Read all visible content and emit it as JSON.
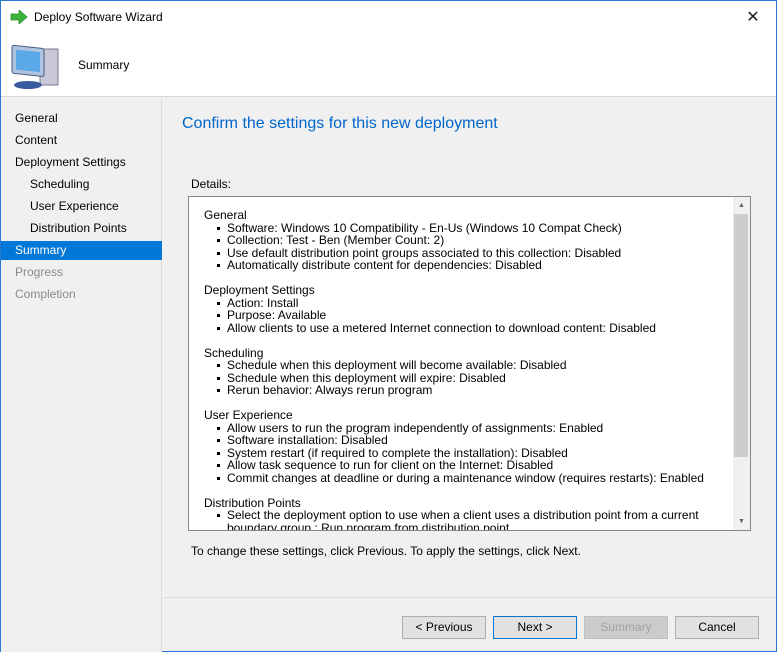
{
  "window": {
    "title": "Deploy Software Wizard",
    "close": "✕"
  },
  "header": {
    "step_title": "Summary"
  },
  "sidebar": {
    "items": [
      {
        "label": "General",
        "level": 0,
        "state": "normal"
      },
      {
        "label": "Content",
        "level": 0,
        "state": "normal"
      },
      {
        "label": "Deployment Settings",
        "level": 0,
        "state": "normal"
      },
      {
        "label": "Scheduling",
        "level": 1,
        "state": "normal"
      },
      {
        "label": "User Experience",
        "level": 1,
        "state": "normal"
      },
      {
        "label": "Distribution Points",
        "level": 1,
        "state": "normal"
      },
      {
        "label": "Summary",
        "level": 0,
        "state": "selected"
      },
      {
        "label": "Progress",
        "level": 0,
        "state": "disabled"
      },
      {
        "label": "Completion",
        "level": 0,
        "state": "disabled"
      }
    ]
  },
  "main": {
    "heading": "Confirm the settings for this new deployment",
    "details_label": "Details:",
    "sections": [
      {
        "title": "General",
        "items": [
          "Software: Windows 10 Compatibility - En-Us (Windows 10 Compat Check)",
          "Collection: Test - Ben (Member Count: 2)",
          "Use default distribution point groups associated to this collection: Disabled",
          "Automatically distribute content for dependencies: Disabled"
        ]
      },
      {
        "title": "Deployment Settings",
        "items": [
          "Action: Install",
          "Purpose: Available",
          "Allow clients to use a metered Internet connection to download content: Disabled"
        ]
      },
      {
        "title": "Scheduling",
        "items": [
          "Schedule when this deployment will become available: Disabled",
          "Schedule when this deployment will expire: Disabled",
          "Rerun behavior: Always rerun program"
        ]
      },
      {
        "title": "User Experience",
        "items": [
          "Allow users to run the program independently of assignments: Enabled",
          "Software installation: Disabled",
          "System restart (if required to complete the installation): Disabled",
          "Allow task sequence to run for client on the Internet: Disabled",
          "Commit changes at deadline or during a maintenance window (requires restarts): Enabled"
        ]
      },
      {
        "title": "Distribution Points",
        "items": [
          "Select the deployment option to use when a client uses a distribution point from a current boundary group.: Run program from distribution point"
        ]
      }
    ],
    "note": "To change these settings, click Previous. To apply the settings, click Next."
  },
  "buttons": {
    "previous": "< Previous",
    "next": "Next >",
    "summary": "Summary",
    "cancel": "Cancel"
  },
  "colors": {
    "accent": "#0078d7",
    "heading": "#0066cc"
  }
}
